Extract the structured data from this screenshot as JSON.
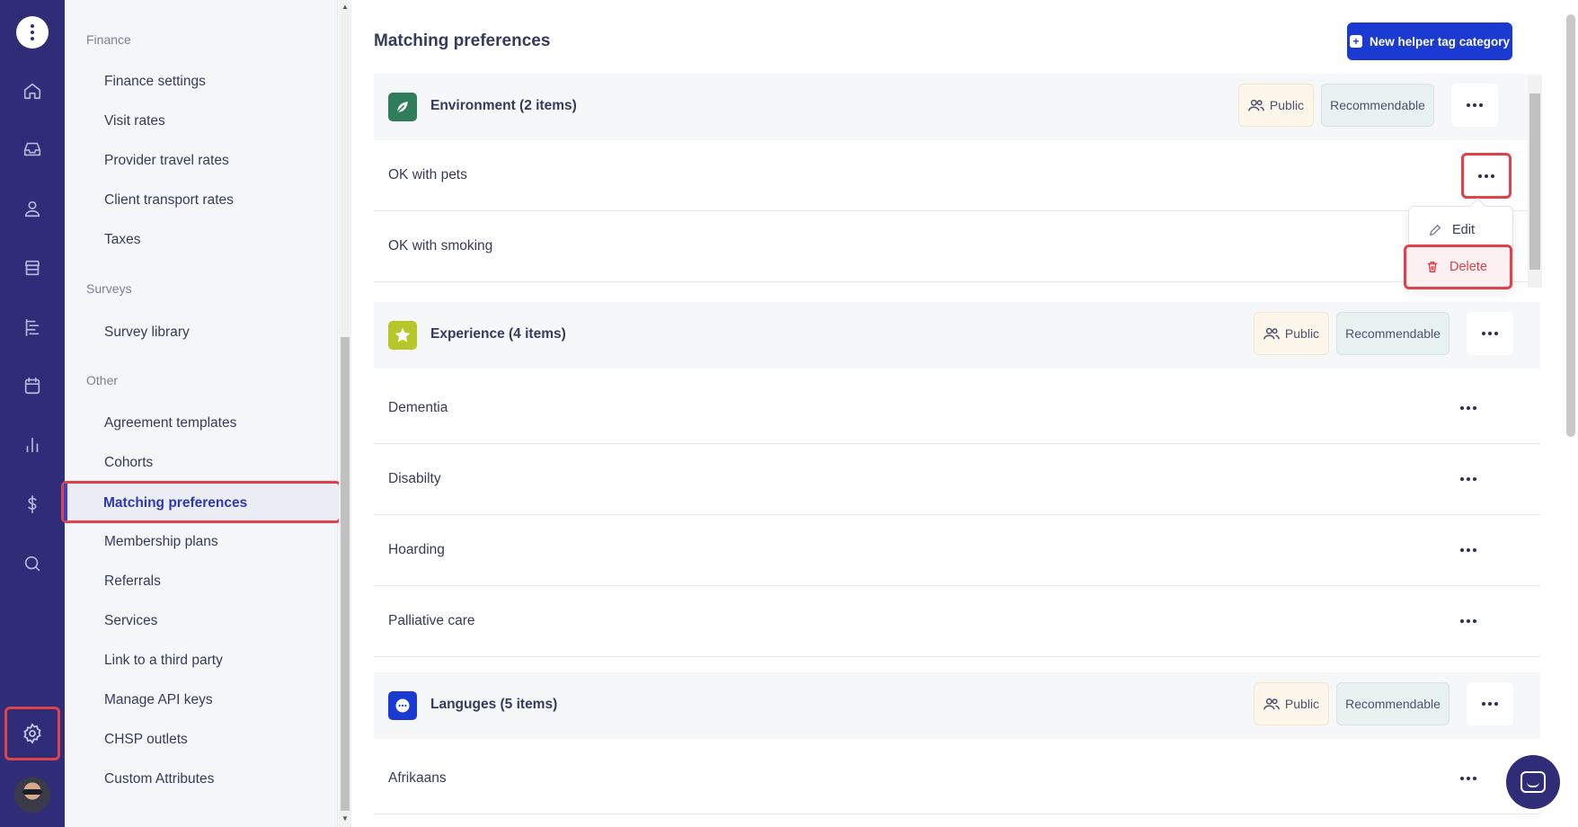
{
  "rail": {
    "items": [
      {
        "name": "home-icon"
      },
      {
        "name": "inbox-icon"
      },
      {
        "name": "person-icon"
      },
      {
        "name": "store-icon"
      },
      {
        "name": "roster-icon"
      },
      {
        "name": "calendar-icon"
      },
      {
        "name": "reports-icon"
      },
      {
        "name": "dollar-icon"
      },
      {
        "name": "search-icon"
      }
    ],
    "settings_icon": "gear-icon"
  },
  "subnav": {
    "groups": {
      "finance": {
        "label": "Finance",
        "items": [
          "Finance settings",
          "Visit rates",
          "Provider travel rates",
          "Client transport rates",
          "Taxes"
        ]
      },
      "surveys": {
        "label": "Surveys",
        "items": [
          "Survey library"
        ]
      },
      "other": {
        "label": "Other",
        "items": [
          "Agreement templates",
          "Cohorts",
          "Matching preferences",
          "Membership plans",
          "Referrals",
          "Services",
          "Link to a third party",
          "Manage API keys",
          "CHSP outlets",
          "Custom Attributes"
        ]
      }
    },
    "active_item": "Matching preferences"
  },
  "main": {
    "title": "Matching preferences",
    "new_button_label": "New helper tag category",
    "categories": [
      {
        "title": "Environment (2 items)",
        "icon": "leaf-icon",
        "icon_color": "#2f7d5b",
        "public_label": "Public",
        "recommendable_label": "Recommendable",
        "items": [
          "OK with pets",
          "OK with smoking"
        ]
      },
      {
        "title": "Experience (4 items)",
        "icon": "star-icon",
        "icon_color": "#b7c72a",
        "public_label": "Public",
        "recommendable_label": "Recommendable",
        "items": [
          "Dementia",
          "Disabilty",
          "Hoarding",
          "Palliative care"
        ]
      },
      {
        "title": "Languges (5 items)",
        "icon": "chat-bubble-icon",
        "icon_color": "#1b3ad1",
        "public_label": "Public",
        "recommendable_label": "Recommendable",
        "items": [
          "Afrikaans"
        ]
      }
    ],
    "dropdown": {
      "edit_label": "Edit",
      "delete_label": "Delete"
    }
  },
  "colors": {
    "rail_bg": "#2f2d78",
    "primary": "#1b3ad1",
    "highlight": "#e0414a"
  }
}
